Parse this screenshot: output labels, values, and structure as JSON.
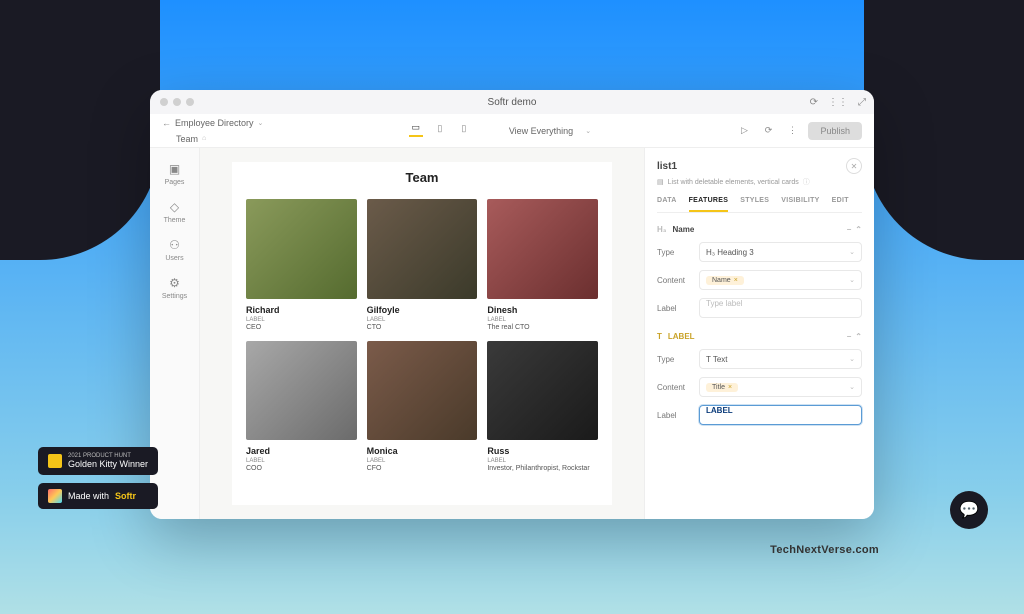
{
  "window": {
    "title": "Softr demo"
  },
  "breadcrumb": {
    "app": "Employee Directory",
    "page": "Team"
  },
  "top": {
    "view_dropdown": "View Everything",
    "publish": "Publish"
  },
  "sidebar": [
    {
      "label": "Pages"
    },
    {
      "label": "Theme"
    },
    {
      "label": "Users"
    },
    {
      "label": "Settings"
    }
  ],
  "canvas": {
    "heading": "Team",
    "cards": [
      {
        "name": "Richard",
        "sub1": "LABEL",
        "sub2": "CEO"
      },
      {
        "name": "Gilfoyle",
        "sub1": "LABEL",
        "sub2": "CTO"
      },
      {
        "name": "Dinesh",
        "sub1": "LABEL",
        "sub2": "The real CTO"
      },
      {
        "name": "Jared",
        "sub1": "LABEL",
        "sub2": "COO"
      },
      {
        "name": "Monica",
        "sub1": "LABEL",
        "sub2": "CFO"
      },
      {
        "name": "Russ",
        "sub1": "LABEL",
        "sub2": "Investor, Philanthropist, Rockstar"
      }
    ]
  },
  "panel": {
    "title": "list1",
    "subtitle": "List with deletable elements, vertical cards",
    "tabs": [
      "DATA",
      "FEATURES",
      "STYLES",
      "VISIBILITY",
      "EDIT"
    ],
    "active_tab": 1,
    "sections": {
      "name": {
        "head": "Name",
        "type_label": "Type",
        "type_value": "H₃ Heading 3",
        "content_label": "Content",
        "content_chip": "Name",
        "label_label": "Label",
        "label_placeholder": "Type label"
      },
      "label": {
        "head": "LABEL",
        "type_label": "Type",
        "type_value": "T Text",
        "content_label": "Content",
        "content_chip": "Title",
        "label_label": "Label",
        "label_value": "LABEL"
      }
    }
  },
  "badges": {
    "kitty_top": "2021 PRODUCT HUNT",
    "kitty_main": "Golden Kitty Winner",
    "made_with": "Made with",
    "made_with_brand": "Softr"
  },
  "watermark": "TechNextVerse.com"
}
